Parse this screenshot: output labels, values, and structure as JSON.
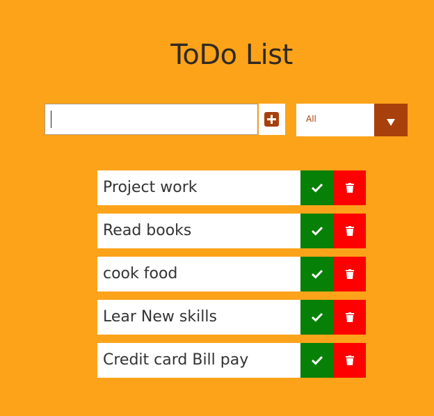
{
  "header": {
    "title": "ToDo List"
  },
  "form": {
    "input_value": "",
    "input_placeholder": "",
    "add_icon": "plus-square-icon",
    "filter_selected": "All",
    "filter_icon": "caret-down-icon"
  },
  "todos": [
    {
      "text": "Project work"
    },
    {
      "text": "Read books"
    },
    {
      "text": "cook food"
    },
    {
      "text": "Lear New skills"
    },
    {
      "text": "Credit card Bill pay"
    }
  ],
  "item_actions": {
    "complete_icon": "check-icon",
    "delete_icon": "trash-icon"
  },
  "colors": {
    "background": "#FDA31A",
    "accent": "#A8400C",
    "complete": "#078007",
    "delete": "#FF0000"
  }
}
